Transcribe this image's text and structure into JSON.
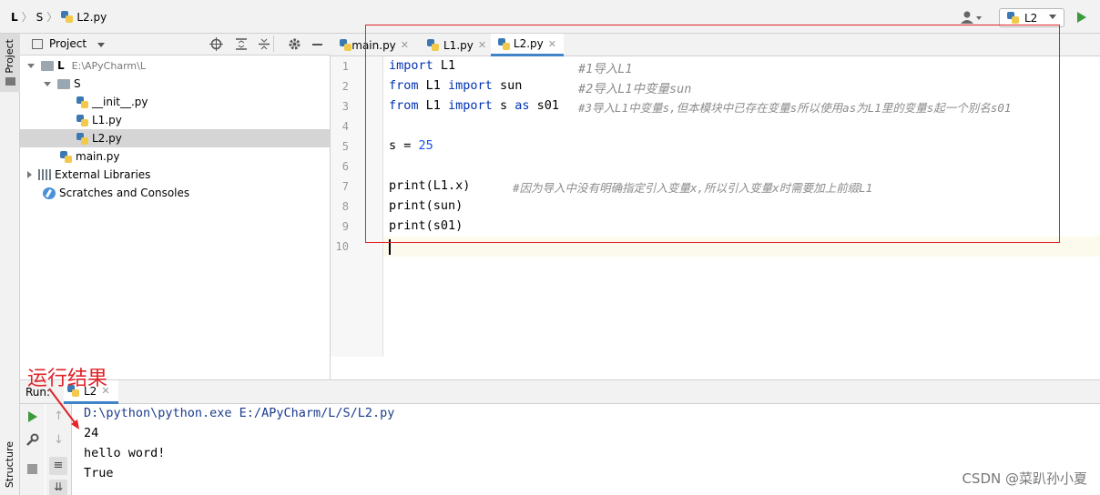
{
  "breadcrumb": {
    "root": "L",
    "folder": "S",
    "file": "L2.py"
  },
  "run_config": {
    "label": "L2"
  },
  "left_strip": {
    "project_tab": "Project",
    "structure_tab": "Structure"
  },
  "project_panel": {
    "title": "Project",
    "tree": [
      {
        "label": "L",
        "path": "E:\\APyCharm\\L"
      },
      {
        "label": "S"
      },
      {
        "label": "__init__.py"
      },
      {
        "label": "L1.py"
      },
      {
        "label": "L2.py"
      },
      {
        "label": "main.py"
      },
      {
        "label": "External Libraries"
      },
      {
        "label": "Scratches and Consoles"
      }
    ]
  },
  "editor": {
    "tabs": [
      {
        "label": "main.py"
      },
      {
        "label": "L1.py"
      },
      {
        "label": "L2.py"
      }
    ],
    "line_numbers": [
      "1",
      "2",
      "3",
      "4",
      "5",
      "6",
      "7",
      "8",
      "9",
      "10"
    ],
    "lines": {
      "l1_kw": "import",
      "l1_rest": " L1",
      "l1_cmt": "#1导入L1",
      "l2_kw1": "from",
      "l2_mid": " L1 ",
      "l2_kw2": "import",
      "l2_rest": " sun",
      "l2_cmt": "#2导入L1中变量sun",
      "l3_kw1": "from",
      "l3_mid": " L1 ",
      "l3_kw2": "import",
      "l3_mid2": " s ",
      "l3_kw3": "as",
      "l3_rest": " s01",
      "l3_cmt": "#3导入L1中变量s,但本模块中已存在变量s所以使用as为L1里的变量s起一个别名s01",
      "l5_pre": "s = ",
      "l5_num": "25",
      "l7_code": "print(L1.x)",
      "l7_cmt": "#因为导入中没有明确指定引入变量x,所以引入变量x时需要加上前缀L1",
      "l8_code": "print(sun)",
      "l9_code": "print(s01)"
    }
  },
  "run_panel": {
    "label": "Run:",
    "tab": "L2",
    "output": [
      "D:\\python\\python.exe E:/APyCharm/L/S/L2.py",
      "24",
      "hello word!",
      "True"
    ]
  },
  "annotation": "运行结果",
  "watermark": "CSDN @菜趴孙小夏"
}
